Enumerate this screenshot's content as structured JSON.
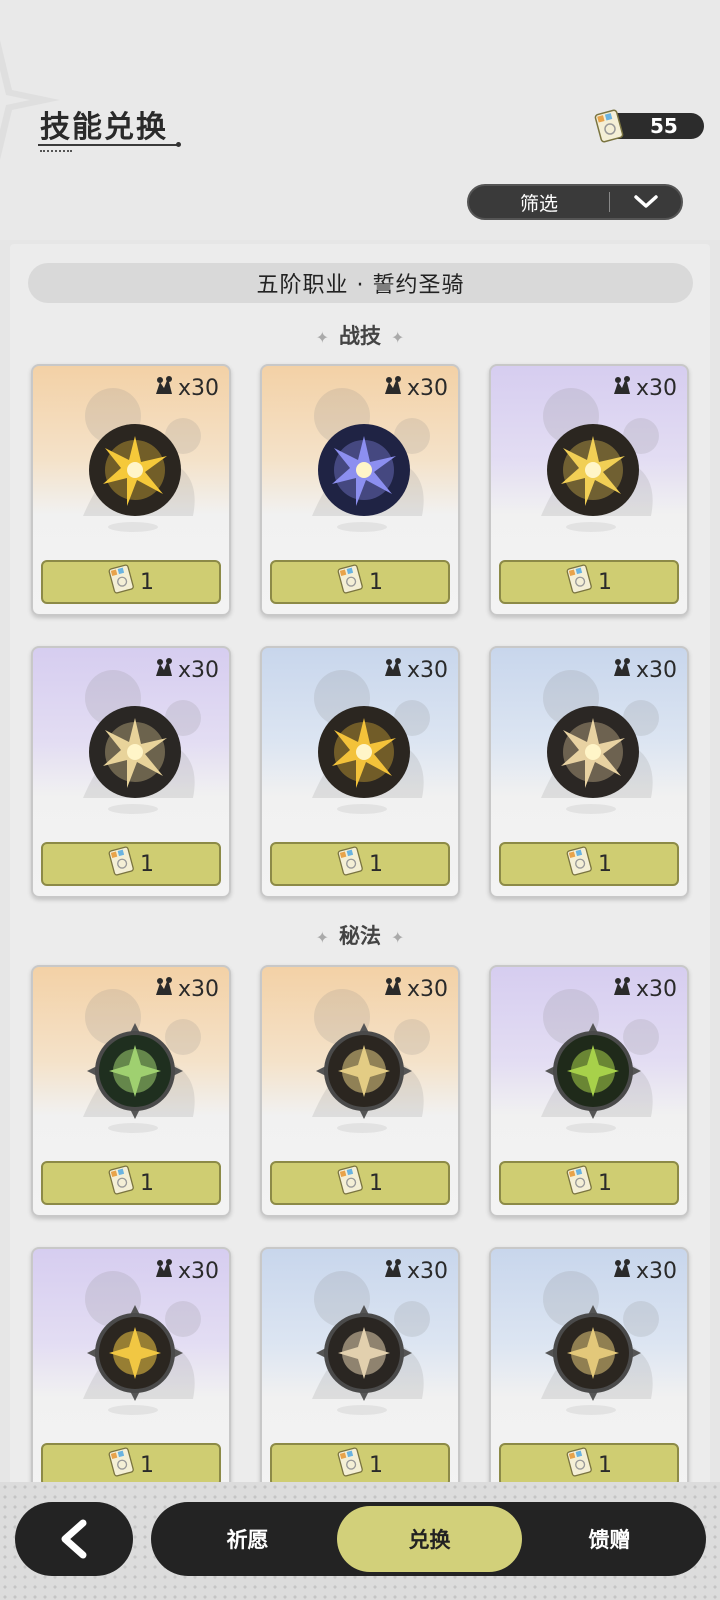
{
  "header": {
    "title": "技能兑换",
    "currency_value": "55",
    "filter_label": "筛选"
  },
  "job": {
    "label": "五阶职业 · 誓约圣骑"
  },
  "sections": [
    {
      "title": "战技",
      "cards": [
        {
          "count": "x30",
          "cost": "1",
          "theme": "orange",
          "icon": "lightning-burst-skill-icon"
        },
        {
          "count": "x30",
          "cost": "1",
          "theme": "orange",
          "icon": "blue-vortex-skill-icon"
        },
        {
          "count": "x30",
          "cost": "1",
          "theme": "purple",
          "icon": "crystal-shield-skill-icon"
        },
        {
          "count": "x30",
          "cost": "1",
          "theme": "purple",
          "icon": "crescent-strike-skill-icon"
        },
        {
          "count": "x30",
          "cost": "1",
          "theme": "blue",
          "icon": "holy-sword-skill-icon"
        },
        {
          "count": "x30",
          "cost": "1",
          "theme": "blue",
          "icon": "light-slash-skill-icon"
        }
      ]
    },
    {
      "title": "秘法",
      "cards": [
        {
          "count": "x30",
          "cost": "1",
          "theme": "orange",
          "icon": "green-shield-arcana-icon"
        },
        {
          "count": "x30",
          "cost": "1",
          "theme": "orange",
          "icon": "golden-star-arcana-icon"
        },
        {
          "count": "x30",
          "cost": "1",
          "theme": "purple",
          "icon": "green-flame-arcana-icon"
        },
        {
          "count": "x30",
          "cost": "1",
          "theme": "purple",
          "icon": "golden-crest-arcana-icon"
        },
        {
          "count": "x30",
          "cost": "1",
          "theme": "blue",
          "icon": "shield-break-arcana-icon"
        },
        {
          "count": "x30",
          "cost": "1",
          "theme": "blue",
          "icon": "compass-star-arcana-icon"
        }
      ]
    }
  ],
  "nav": {
    "tabs": [
      {
        "label": "祈愿",
        "active": false
      },
      {
        "label": "兑换",
        "active": true
      },
      {
        "label": "馈赠",
        "active": false
      }
    ]
  },
  "colors": {
    "button_fill": "#cfcd72",
    "nav_dark": "#232323",
    "active_tab": "#d2d07a"
  }
}
